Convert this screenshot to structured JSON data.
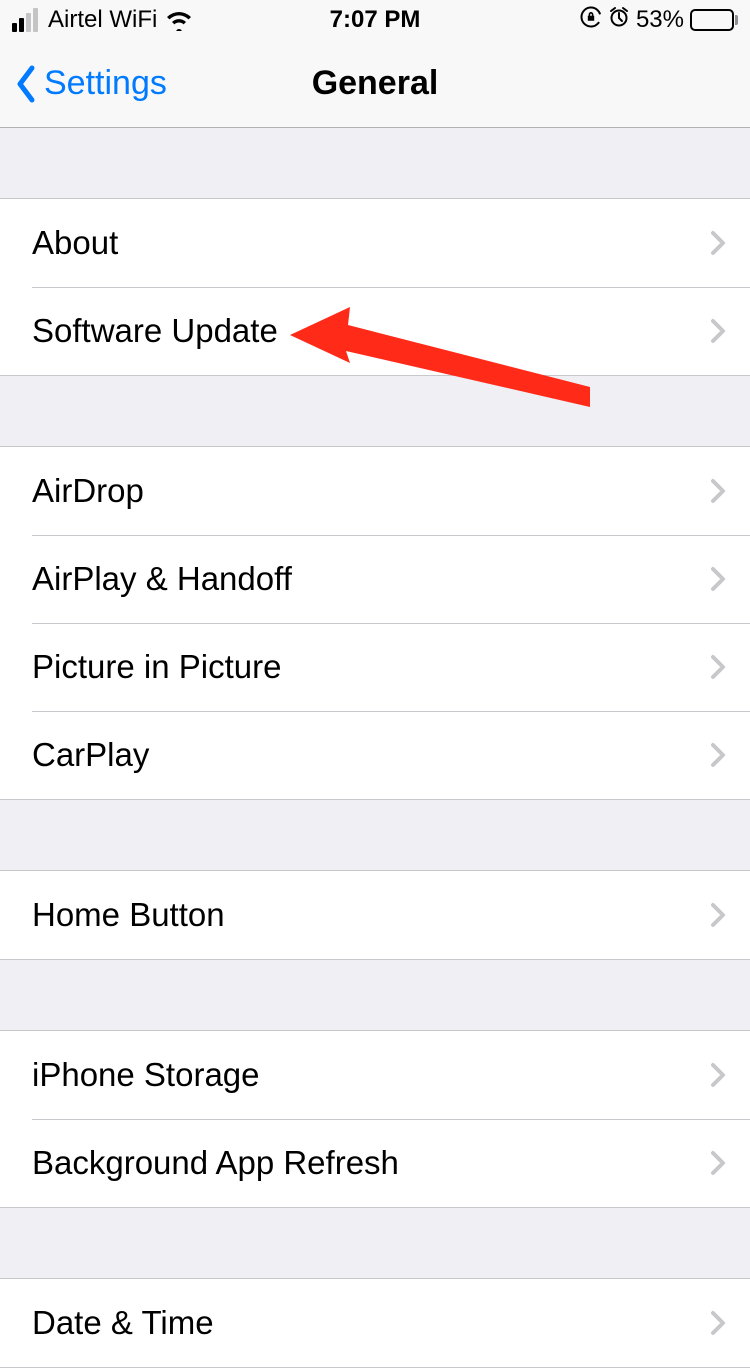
{
  "statusbar": {
    "carrier": "Airtel WiFi",
    "time": "7:07 PM",
    "battery_pct": "53%"
  },
  "nav": {
    "back_label": "Settings",
    "title": "General"
  },
  "sections": {
    "s0": [
      {
        "label": "About"
      },
      {
        "label": "Software Update"
      }
    ],
    "s1": [
      {
        "label": "AirDrop"
      },
      {
        "label": "AirPlay & Handoff"
      },
      {
        "label": "Picture in Picture"
      },
      {
        "label": "CarPlay"
      }
    ],
    "s2": [
      {
        "label": "Home Button"
      }
    ],
    "s3": [
      {
        "label": "iPhone Storage"
      },
      {
        "label": "Background App Refresh"
      }
    ],
    "s4": [
      {
        "label": "Date & Time"
      }
    ]
  }
}
